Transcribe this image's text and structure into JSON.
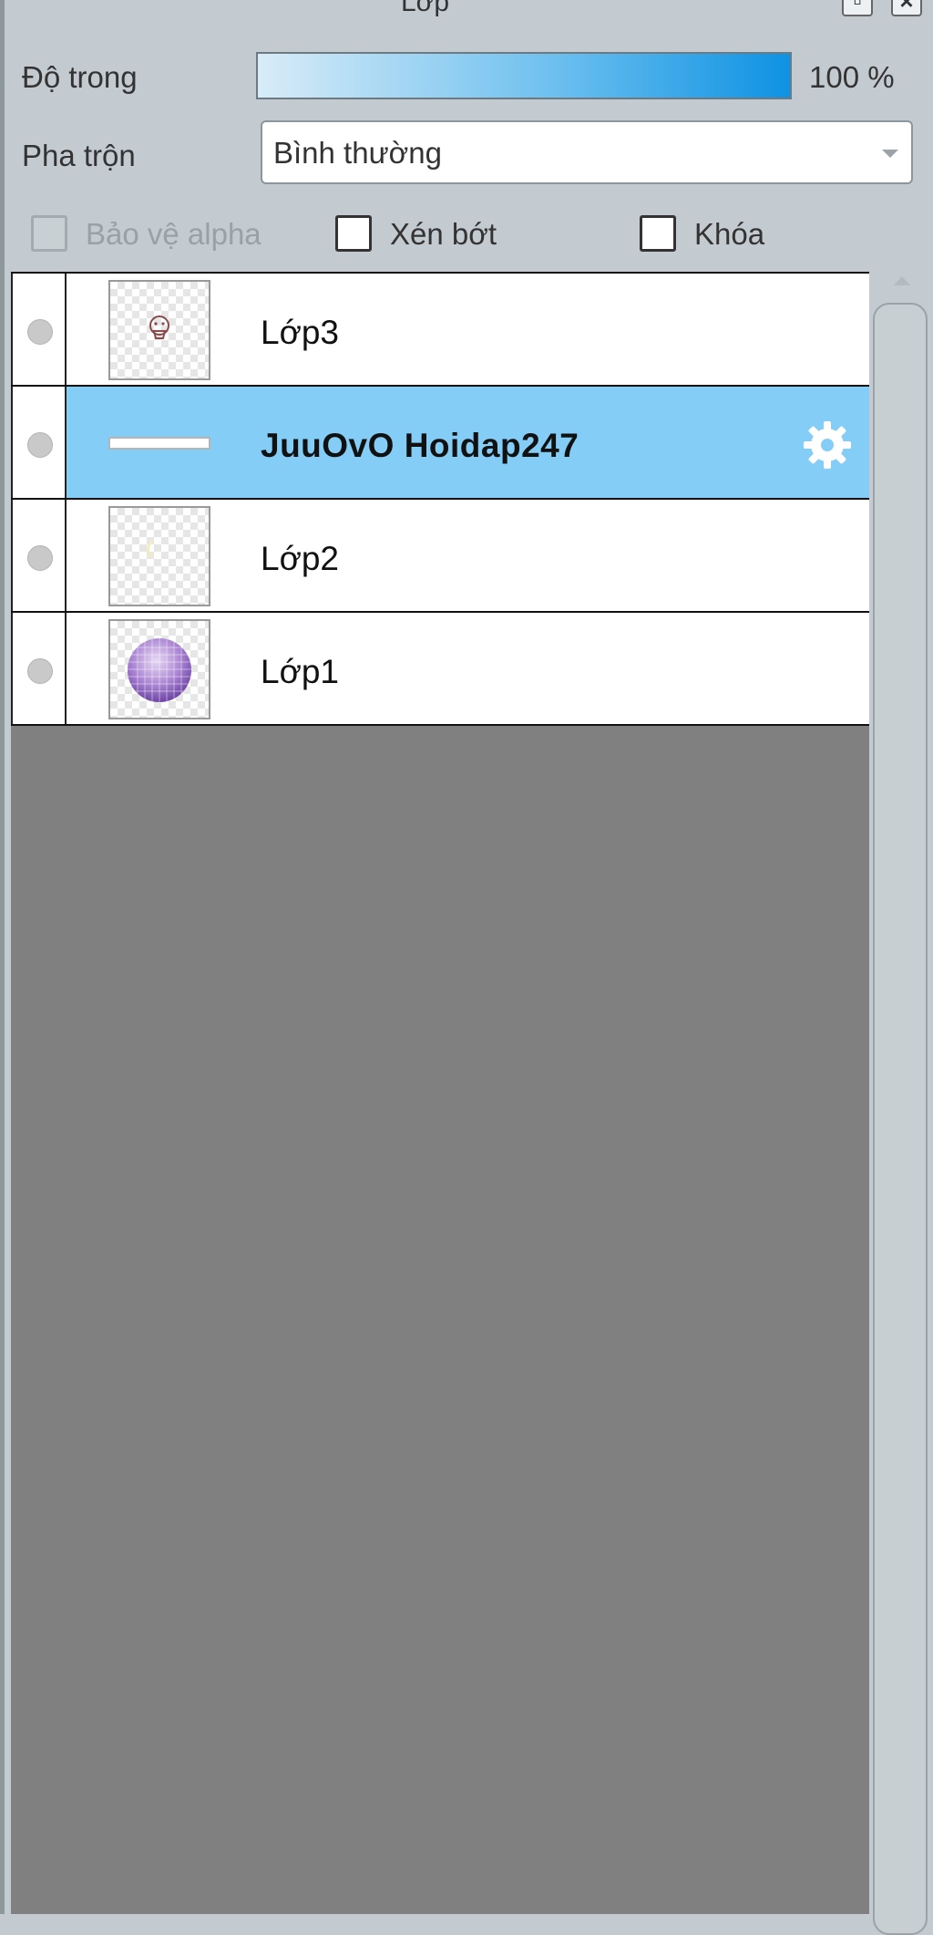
{
  "window": {
    "title": "Lớp",
    "float_icon": "float-window-icon",
    "close_icon": "close-icon"
  },
  "opacity": {
    "label": "Độ trong",
    "value_percent": 100,
    "display": "100 %",
    "fill_color": "#0e92e3"
  },
  "blend": {
    "label": "Pha trộn",
    "value": "Bình thường"
  },
  "options": {
    "protect_alpha": {
      "label": "Bảo vệ alpha",
      "checked": false,
      "disabled": true
    },
    "clipping": {
      "label": "Xén bớt",
      "checked": false
    },
    "lock": {
      "label": "Khóa",
      "checked": false
    }
  },
  "layers": [
    {
      "name": "Lớp3",
      "selected": false,
      "thumb": "small-face-drawing"
    },
    {
      "name": "JuuOvO Hoidap247",
      "selected": true,
      "thumb": "text-line",
      "icon": "gear-icon"
    },
    {
      "name": "Lớp2",
      "selected": false,
      "thumb": "faint-sketch"
    },
    {
      "name": "Lớp1",
      "selected": false,
      "thumb": "purple-sphere"
    }
  ],
  "colors": {
    "selected_row": "#84cdf6",
    "panel_bg": "#c3cbd0",
    "list_bg": "#808080"
  }
}
